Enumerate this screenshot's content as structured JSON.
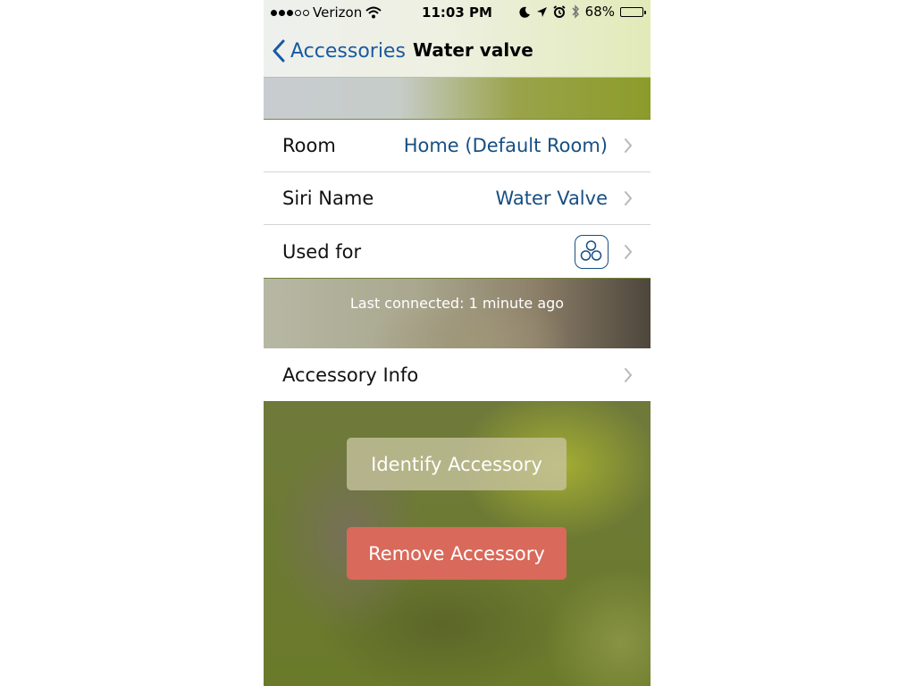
{
  "status_bar": {
    "carrier": "Verizon",
    "time": "11:03 PM",
    "battery_percent": "68%",
    "battery_level": 0.68,
    "signal_bars_filled": 3,
    "signal_bars_total": 5,
    "icons": [
      "wifi-icon",
      "moon-icon",
      "location-arrow-icon",
      "alarm-icon",
      "bluetooth-icon",
      "battery-icon"
    ]
  },
  "nav": {
    "back_label": "Accessories",
    "title": "Water valve"
  },
  "settings": {
    "rows": [
      {
        "label": "Room",
        "value": "Home (Default Room)"
      },
      {
        "label": "Siri Name",
        "value": "Water Valve"
      },
      {
        "label": "Used for",
        "icon": "three-circles-icon"
      }
    ]
  },
  "last_connected": "Last connected: 1 minute ago",
  "info_row": {
    "label": "Accessory Info"
  },
  "buttons": {
    "identify": "Identify Accessory",
    "remove": "Remove Accessory"
  },
  "colors": {
    "accent": "#1a5aa0",
    "value_text": "#174f82",
    "destructive": "#d9695a"
  }
}
